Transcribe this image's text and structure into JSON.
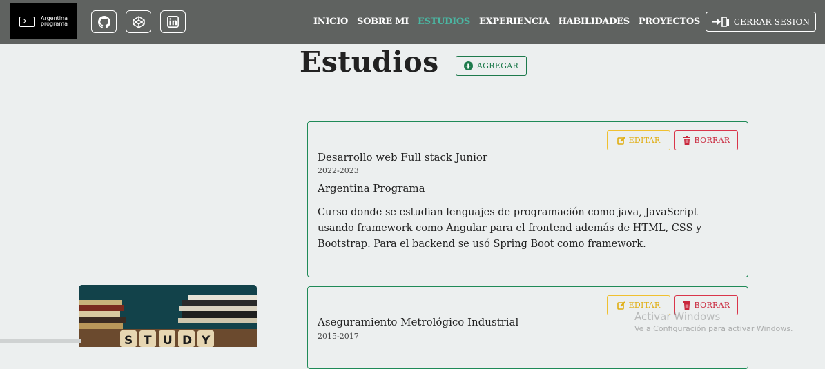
{
  "navbar": {
    "logo_line1": "Argentina",
    "logo_line2": "programa",
    "links": [
      "INICIO",
      "SOBRE MI",
      "ESTUDIOS",
      "EXPERIENCIA",
      "HABILIDADES",
      "PROYECTOS"
    ],
    "active_link": "ESTUDIOS",
    "logout_label": "CERRAR SESION",
    "social_icons": [
      "github-icon",
      "codepen-icon",
      "linkedin-icon"
    ]
  },
  "page": {
    "title": "Estudios",
    "add_label": "AGREGAR"
  },
  "cards": [
    {
      "title": "Desarrollo web Full stack Junior",
      "years": "2022-2023",
      "institution": "Argentina Programa",
      "description": "Curso donde se estudian lenguajes de programación como java, JavaScript usando framework como Angular para el frontend además de HTML, CSS y Bootstrap. Para el backend se usó Spring Boot como framework.",
      "edit_label": "EDITAR",
      "delete_label": "BORRAR"
    },
    {
      "title": "Aseguramiento Metrológico Industrial",
      "years": "2015-2017",
      "edit_label": "EDITAR",
      "delete_label": "BORRAR"
    }
  ],
  "image": {
    "caption": "STUDY"
  },
  "watermark": {
    "title": "Activar Windows",
    "subtitle": "Ve a Configuración para activar Windows."
  },
  "colors": {
    "navbar_bg": "#5f6260",
    "active_link": "#4bb6a2",
    "add_green": "#1e7a4c",
    "edit_yellow": "#e0ad10",
    "delete_red": "#c9283d"
  }
}
